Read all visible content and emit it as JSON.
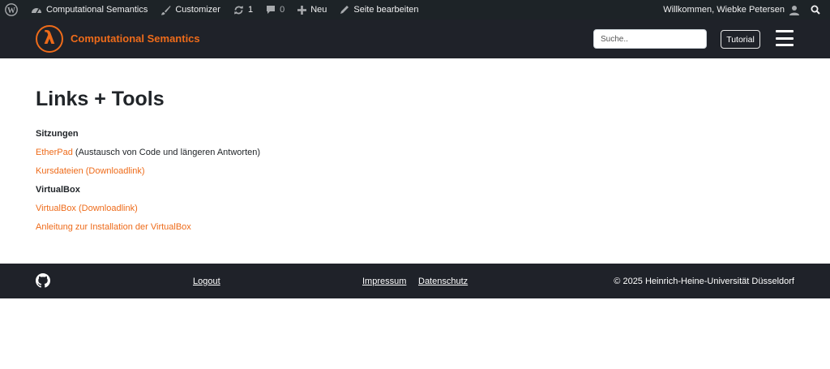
{
  "admin_bar": {
    "site_name": "Computational Semantics",
    "customizer": "Customizer",
    "updates_count": "1",
    "comments_count": "0",
    "new": "Neu",
    "edit_page": "Seite bearbeiten",
    "welcome": "Willkommen, Wiebke Petersen"
  },
  "header": {
    "logo_glyph": "λ",
    "brand": "Computational Semantics",
    "search_placeholder": "Suche..",
    "tutorial_label": "Tutorial",
    "accent_color": "#ee6b1a"
  },
  "content": {
    "title": "Links + Tools",
    "sections": [
      {
        "heading": "Sitzungen",
        "items": [
          {
            "link": "EtherPad",
            "suffix": " (Austausch von Code und längeren Antworten)"
          },
          {
            "link": "Kursdateien (Downloadlink)",
            "suffix": ""
          }
        ]
      },
      {
        "heading": "VirtualBox",
        "items": [
          {
            "link": "VirtualBox (Downloadlink)",
            "suffix": ""
          },
          {
            "link": "Anleitung zur Installation der VirtualBox",
            "suffix": ""
          }
        ]
      }
    ]
  },
  "footer": {
    "logout": "Logout",
    "impressum": "Impressum",
    "datenschutz": "Datenschutz",
    "copyright": "© 2025 Heinrich-Heine-Universität Düsseldorf"
  }
}
